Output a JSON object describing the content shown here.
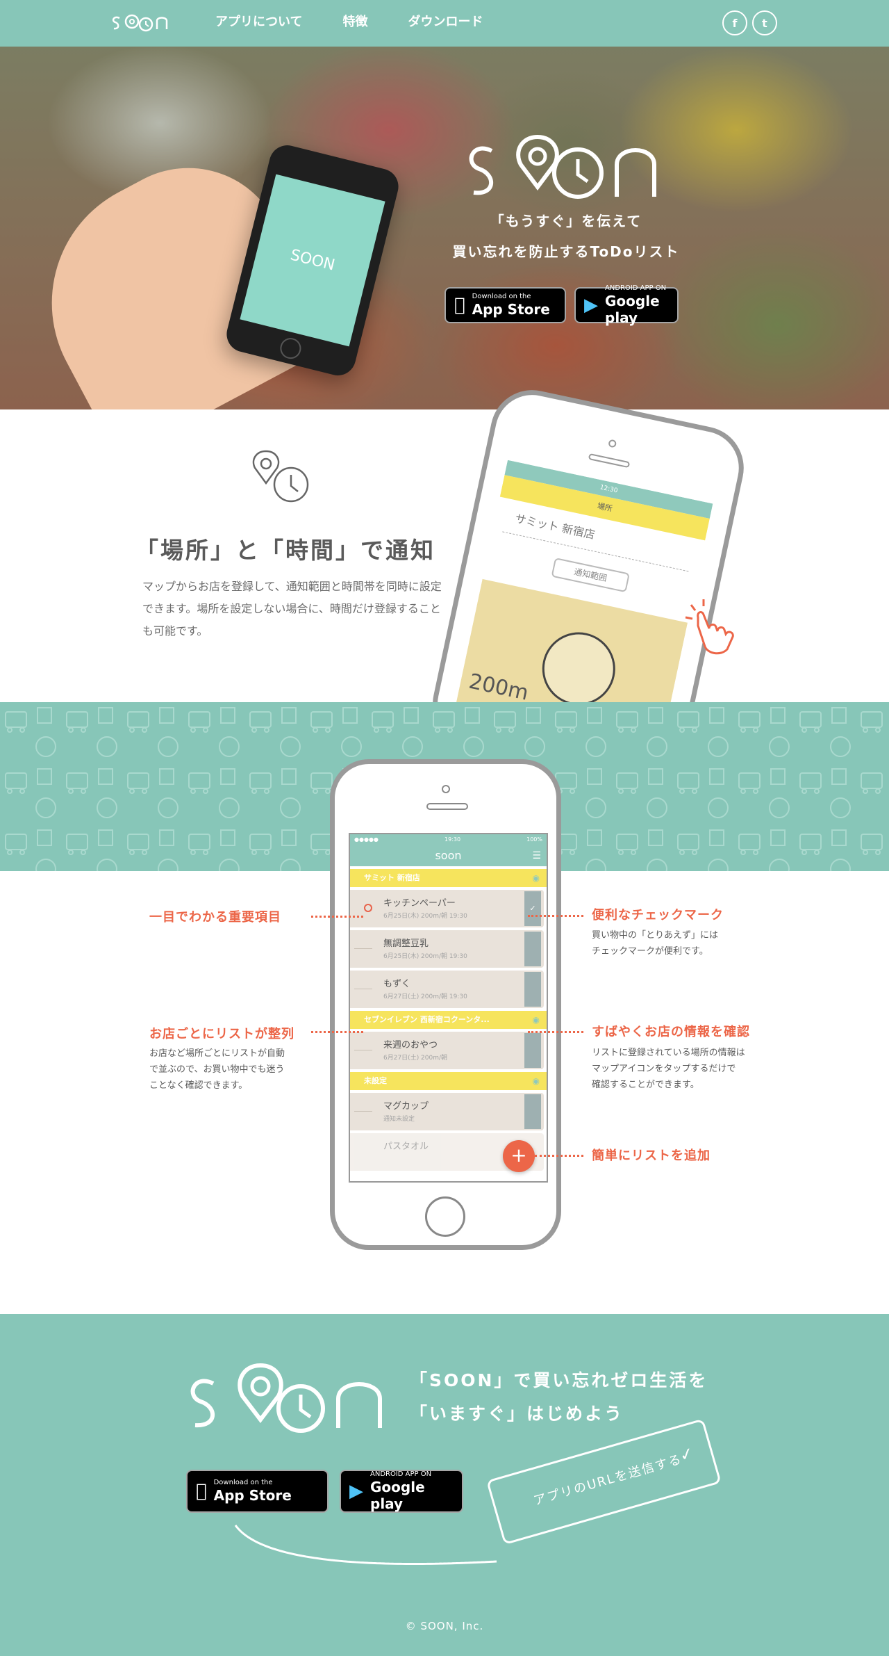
{
  "header": {
    "logo": "SOON",
    "nav": [
      "アプリについて",
      "特徴",
      "ダウンロード"
    ],
    "social": [
      {
        "icon": "facebook-icon",
        "glyph": "f"
      },
      {
        "icon": "twitter-icon",
        "glyph": "t"
      }
    ]
  },
  "hero": {
    "tagline1": "「もうすぐ」を伝えて",
    "tagline2": "買い忘れを防止するToDoリスト",
    "appstore_small": "Download on the",
    "appstore_big": "App Store",
    "googleplay_small": "ANDROID APP ON",
    "googleplay_big": "Google play"
  },
  "feature": {
    "title": "「場所」と「時間」で通知",
    "desc": "マップからお店を登録して、通知範囲と時間帯を同時に設定できます。場所を設定しない場合に、時間だけ登録することも可能です。"
  },
  "map_phone": {
    "status": "12:30",
    "title": "場所",
    "store": "サミット 新宿店",
    "range_label": "通知範囲",
    "distance": "200m"
  },
  "list_phone": {
    "time": "19:30",
    "battery": "100%",
    "app": "soon",
    "groups": [
      {
        "name": "サミット 新宿店",
        "items": [
          {
            "name": "キッチンペーパー",
            "meta": "6月25日(木)  200m/朝  19:30",
            "marked": true
          },
          {
            "name": "無調整豆乳",
            "meta": "6月25日(木)  200m/朝  19:30",
            "marked": false
          },
          {
            "name": "もずく",
            "meta": "6月27日(土)  200m/朝  19:30",
            "marked": false
          }
        ]
      },
      {
        "name": "セブンイレブン 西新宿コクーンタ...",
        "items": [
          {
            "name": "来週のおやつ",
            "meta": "6月27日(土)  200m/朝",
            "marked": false
          }
        ]
      },
      {
        "name": "未設定",
        "items": [
          {
            "name": "マグカップ",
            "meta": "通知未設定",
            "marked": false
          },
          {
            "name": "パスタオル",
            "meta": "",
            "marked": false
          }
        ]
      }
    ]
  },
  "callouts": {
    "important": {
      "title": "一目でわかる重要項目"
    },
    "check": {
      "title": "便利なチェックマーク",
      "desc": "買い物中の「とりあえず」には\nチェックマークが便利です。"
    },
    "store_list": {
      "title": "お店ごとにリストが整列",
      "desc": "お店など場所ごとにリストが自動\nで並ぶので、お買い物中でも迷う\nことなく確認できます。"
    },
    "store_info": {
      "title": "すばやくお店の情報を確認",
      "desc": "リストに登録されている場所の情報は\nマップアイコンをタップするだけで\n確認することができます。"
    },
    "add": {
      "title": "簡単にリストを追加"
    }
  },
  "cta": {
    "line1": "「SOON」で買い忘れゼロ生活を",
    "line2": "「いますぐ」はじめよう",
    "send_label": "アプリのURLを送信する",
    "copyright": "© SOON, Inc."
  },
  "colors": {
    "teal": "#87c6b8",
    "orange": "#ec6648",
    "yellow": "#f6e45d",
    "text": "#5a5a5a"
  }
}
